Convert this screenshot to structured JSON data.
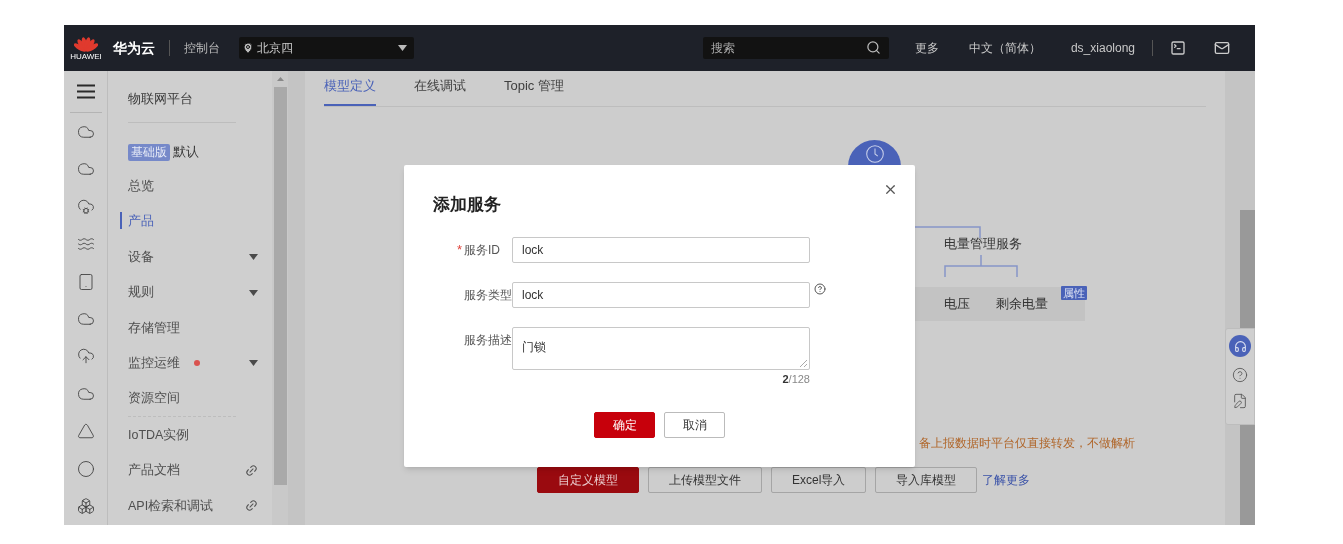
{
  "top_bar": {
    "logo_text": "HUAWEI",
    "brand": "华为云",
    "console": "控制台",
    "region": "北京四",
    "search": {
      "placeholder": "搜索"
    },
    "links": [
      "更多",
      "中文（简体）",
      "ds_xiaolong"
    ]
  },
  "nav": {
    "title": "物联网平台",
    "edition_badge": "基础版",
    "edition": "默认",
    "items": [
      {
        "label": "总览",
        "kind": "plain",
        "selected": false,
        "alert": false
      },
      {
        "label": "产品",
        "kind": "plain",
        "selected": true,
        "alert": false
      },
      {
        "label": "设备",
        "kind": "expand",
        "selected": false,
        "alert": false
      },
      {
        "label": "规则",
        "kind": "expand",
        "selected": false,
        "alert": false
      },
      {
        "label": "存储管理",
        "kind": "plain",
        "selected": false,
        "alert": false
      },
      {
        "label": "监控运维",
        "kind": "expand",
        "selected": false,
        "alert": true
      },
      {
        "label": "资源空间",
        "kind": "plain",
        "selected": false,
        "alert": false
      },
      {
        "label": "IoTDA实例",
        "kind": "plain",
        "selected": false,
        "alert": false
      },
      {
        "label": "产品文档",
        "kind": "link",
        "selected": false,
        "alert": false
      },
      {
        "label": "API检索和调试",
        "kind": "link",
        "selected": false,
        "alert": false
      }
    ]
  },
  "tabs": [
    {
      "label": "模型定义",
      "selected": true
    },
    {
      "label": "在线调试",
      "selected": false
    },
    {
      "label": "Topic 管理",
      "selected": false
    }
  ],
  "diagram": {
    "service": "电量管理服务",
    "properties": [
      "电压",
      "剩余电量"
    ],
    "tag": "属性"
  },
  "notice": "备上报数据时平台仅直接转发，不做解析",
  "actions": [
    {
      "label": "自定义模型",
      "primary": true
    },
    {
      "label": "上传模型文件",
      "primary": false
    },
    {
      "label": "Excel导入",
      "primary": false
    },
    {
      "label": "导入库模型",
      "primary": false
    }
  ],
  "learn_more": "了解更多",
  "dialog": {
    "title": "添加服务",
    "required_mark": "*",
    "fields": [
      {
        "label": "服务ID",
        "value": "lock",
        "required": true,
        "help": false,
        "kind": "input"
      },
      {
        "label": "服务类型",
        "value": "lock",
        "required": false,
        "help": true,
        "kind": "input"
      },
      {
        "label": "服务描述",
        "value": "门锁",
        "required": false,
        "help": false,
        "kind": "textarea"
      }
    ],
    "counter": "**2**/128",
    "buttons": [
      {
        "label": "确定",
        "primary": true
      },
      {
        "label": "取消",
        "primary": false
      }
    ]
  }
}
